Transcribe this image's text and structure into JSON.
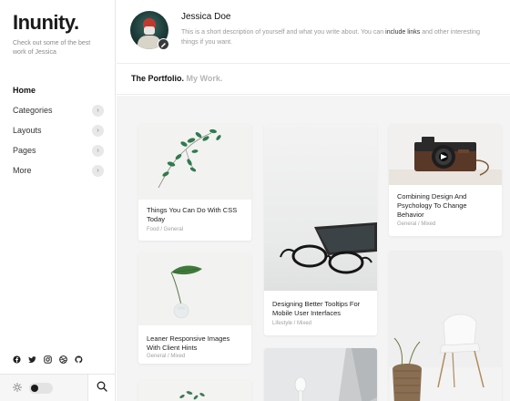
{
  "brand": {
    "name": "Inunity",
    "dot": "."
  },
  "tagline": "Check out some of the best work of Jessica",
  "nav": [
    {
      "label": "Home",
      "active": true,
      "has_chevron": false
    },
    {
      "label": "Categories",
      "active": false,
      "has_chevron": true
    },
    {
      "label": "Layouts",
      "active": false,
      "has_chevron": true
    },
    {
      "label": "Pages",
      "active": false,
      "has_chevron": true
    },
    {
      "label": "More",
      "active": false,
      "has_chevron": true
    }
  ],
  "social_icons": [
    "facebook-icon",
    "twitter-icon",
    "instagram-icon",
    "dribbble-icon",
    "github-icon"
  ],
  "author": {
    "name": "Jessica Doe",
    "bio_before": "This is a short description of yourself and what you write about. You can ",
    "bio_link": "include links",
    "bio_after": " and other interesting things if you want."
  },
  "section": {
    "title": "The Portfolio.",
    "muted": "My Work."
  },
  "cards": [
    {
      "title": "Things You Can Do With CSS Today",
      "meta": "Food / General"
    },
    {
      "title": "Designing Better Tooltips For Mobile User Interfaces",
      "meta": "Lifestyle / Mixed"
    },
    {
      "title": "Combining Design And Psychology To Change Behavior",
      "meta": "General / Mixed"
    },
    {
      "title": "Leaner Responsive Images With Client Hints",
      "meta": "General / Mixed"
    }
  ],
  "colors": {
    "accent": "#1a1a1a",
    "muted": "#9a9a9a",
    "background": "#f4f4f4"
  }
}
